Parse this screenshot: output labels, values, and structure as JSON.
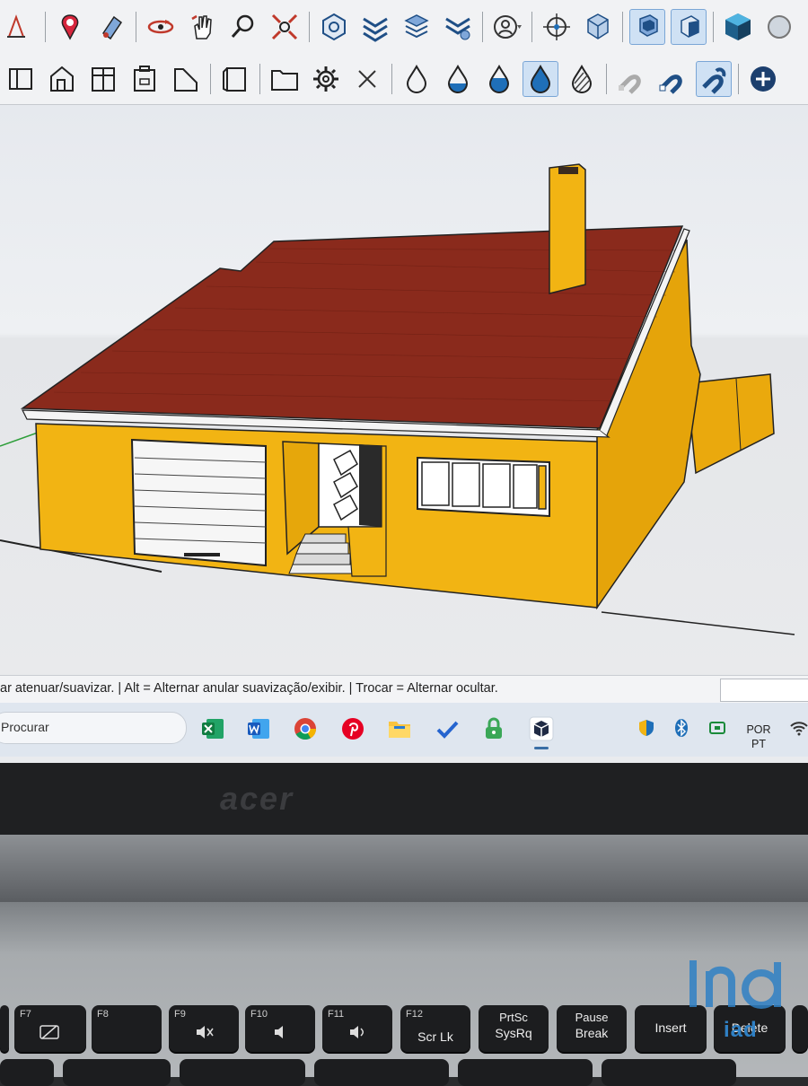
{
  "toolbar_top": {
    "icons": [
      "section-icon",
      "location-icon",
      "paint-icon",
      "orbit-icon",
      "pan-icon",
      "zoom-icon",
      "zoom-extents-icon",
      "solid-tools-icon",
      "layers-icon",
      "styles-icon",
      "components-icon",
      "account-icon",
      "target-icon",
      "model-info-icon",
      "warehouse-icon",
      "extension-icon",
      "cube-icon",
      "sketchup-3d-icon"
    ]
  },
  "toolbar_bottom": {
    "icons": [
      "view-front-icon",
      "view-home-icon",
      "view-right-icon",
      "view-back-icon",
      "view-left-icon",
      "view-iso-icon",
      "folder-icon",
      "gear-icon",
      "close-icon",
      "drop-outline-icon",
      "drop-half-icon",
      "drop-mid-icon",
      "drop-full-icon",
      "drop-hatched-icon",
      "magnet-off-icon",
      "magnet-icon",
      "magnet-active-icon",
      "add-icon"
    ]
  },
  "statusbar": {
    "hint": "ar atenuar/suavizar. | Alt = Alternar anular suavização/exibir. | Trocar = Alternar ocultar.",
    "measurements_value": ""
  },
  "taskbar": {
    "search_text": "Procurar",
    "apps": [
      "excel-icon",
      "word-icon",
      "chrome-icon",
      "pinterest-icon",
      "file-explorer-icon",
      "todo-icon",
      "vpn-icon",
      "sketchup-icon"
    ],
    "tray_icons": [
      "defender-icon",
      "bluetooth-icon",
      "network-tray-icon",
      "wifi-icon"
    ],
    "language_top": "POR",
    "language_bottom": "PT"
  },
  "laptop": {
    "brand": "acer",
    "keys": [
      {
        "fn": "F7",
        "label": ""
      },
      {
        "fn": "F8",
        "label": ""
      },
      {
        "fn": "F9",
        "label": ""
      },
      {
        "fn": "F10",
        "label": ""
      },
      {
        "fn": "F11",
        "label": ""
      },
      {
        "fn": "F12",
        "label": "Scr Lk"
      },
      {
        "fn": "PrtSc",
        "label": "SysRq"
      },
      {
        "fn": "Pause",
        "label": "Break"
      },
      {
        "fn": "",
        "label": "Insert"
      },
      {
        "fn": "",
        "label": "Delete"
      }
    ]
  },
  "watermark": {
    "text": "iad"
  },
  "colors": {
    "house_wall": "#f2b413",
    "roof": "#8a2a1c",
    "accent_blue": "#1f6fb8"
  }
}
